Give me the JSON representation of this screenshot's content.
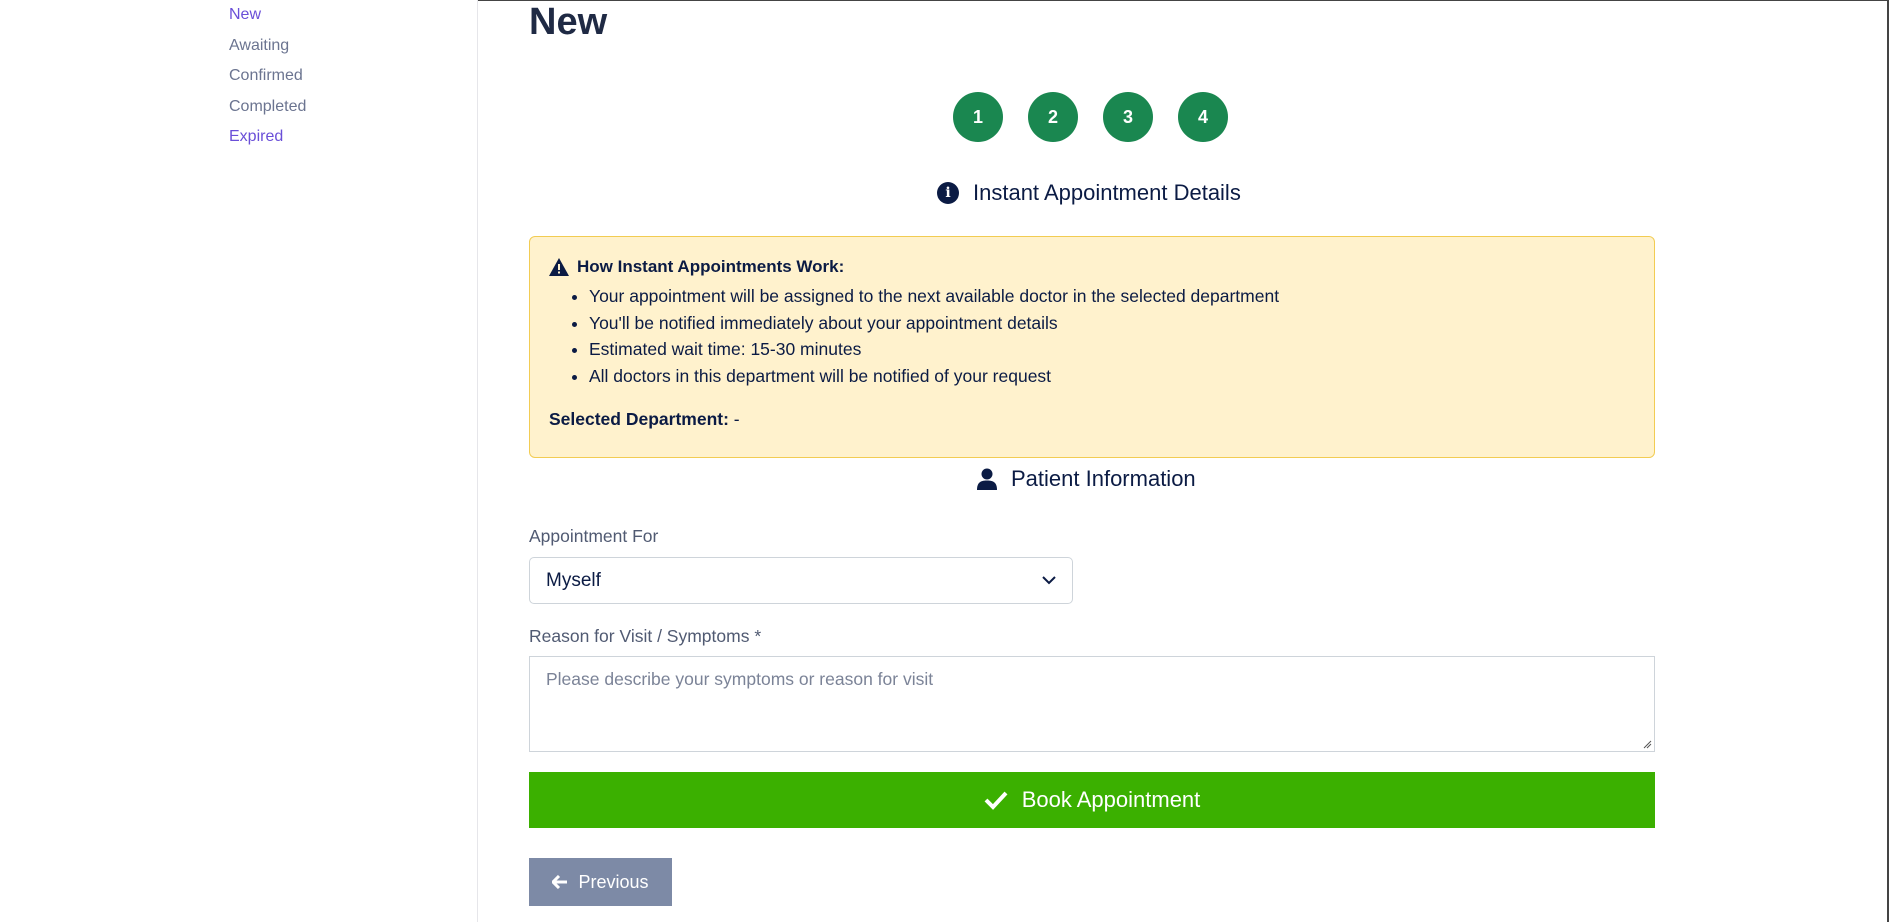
{
  "sidebar": {
    "items": [
      {
        "label": "New"
      },
      {
        "label": "Awaiting"
      },
      {
        "label": "Confirmed"
      },
      {
        "label": "Completed"
      },
      {
        "label": "Expired"
      }
    ]
  },
  "main": {
    "title": "New",
    "steps": [
      "1",
      "2",
      "3",
      "4"
    ],
    "details_heading": "Instant Appointment Details",
    "alert": {
      "title": "How Instant Appointments Work:",
      "items": [
        "Your appointment will be assigned to the next available doctor in the selected department",
        "You'll be notified immediately about your appointment details",
        "Estimated wait time: 15-30 minutes",
        "All doctors in this department will be notified of your request"
      ],
      "dept_label": "Selected Department:",
      "dept_value": "-"
    },
    "patient_heading": "Patient Information",
    "appointment_for": {
      "label": "Appointment For",
      "value": "Myself"
    },
    "reason": {
      "label": "Reason for Visit / Symptoms *",
      "placeholder": "Please describe your symptoms or reason for visit"
    },
    "book_label": "Book Appointment",
    "previous_label": "Previous"
  },
  "colors": {
    "accent": "#6a4fd8",
    "step_green": "#1a8750",
    "book_green": "#3bb000",
    "alert_bg": "#fff2cd",
    "alert_border": "#f2cc53",
    "prev_gray": "#7d8aa6"
  },
  "icons": [
    "info-circle-icon",
    "warning-triangle-icon",
    "user-icon",
    "chevron-down-icon",
    "check-icon",
    "arrow-left-icon"
  ]
}
